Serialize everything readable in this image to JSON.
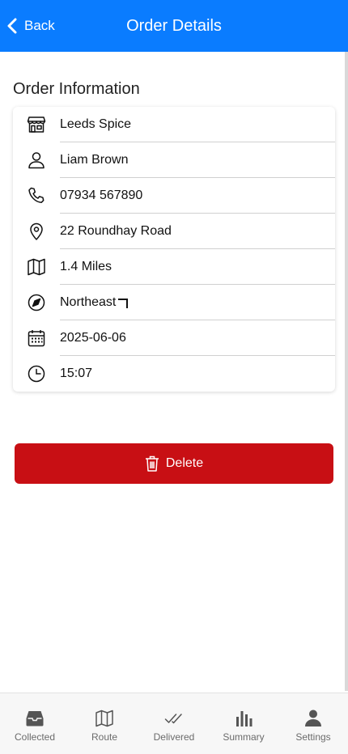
{
  "header": {
    "back_label": "Back",
    "title": "Order Details",
    "color": "#0a7cff"
  },
  "section": {
    "title": "Order Information"
  },
  "order": {
    "rows": [
      {
        "icon": "store-icon",
        "value": "Leeds Spice"
      },
      {
        "icon": "person-icon",
        "value": "Liam Brown"
      },
      {
        "icon": "phone-icon",
        "value": "07934 567890"
      },
      {
        "icon": "location-pin-icon",
        "value": "22 Roundhay Road"
      },
      {
        "icon": "map-icon",
        "value": "1.4 Miles"
      },
      {
        "icon": "compass-icon",
        "value": "Northeast"
      },
      {
        "icon": "calendar-icon",
        "value": "2025-06-06"
      },
      {
        "icon": "clock-icon",
        "value": "15:07"
      }
    ]
  },
  "actions": {
    "delete_label": "Delete",
    "delete_color": "#c80f14"
  },
  "tabbar": {
    "tabs": [
      {
        "label": "Collected",
        "icon": "inbox-tray-icon"
      },
      {
        "label": "Route",
        "icon": "map-icon"
      },
      {
        "label": "Delivered",
        "icon": "double-check-icon"
      },
      {
        "label": "Summary",
        "icon": "bar-chart-icon"
      },
      {
        "label": "Settings",
        "icon": "person-icon"
      }
    ]
  }
}
